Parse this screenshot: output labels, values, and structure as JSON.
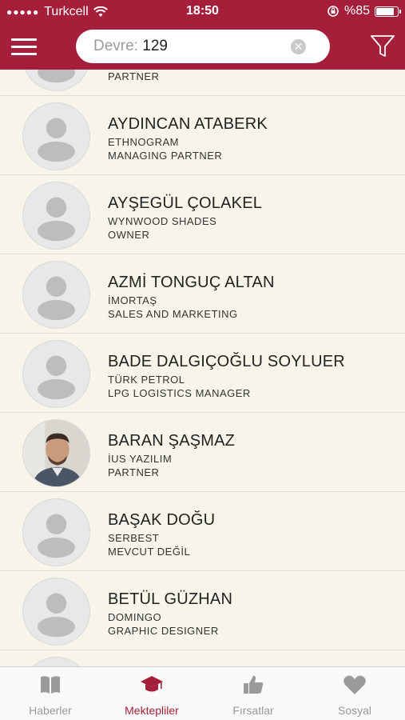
{
  "status_bar": {
    "carrier": "Turkcell",
    "time": "18:50",
    "battery": "%85",
    "battery_level": 0.85
  },
  "search": {
    "placeholder": "Devre:",
    "value": "129"
  },
  "list": {
    "partial_top": {
      "title": "PARTNER"
    },
    "members": [
      {
        "name": "AYDINCAN ATABERK",
        "company": "ETHNOGRAM",
        "title": "MANAGING PARTNER",
        "photo": false
      },
      {
        "name": "AYŞEGÜL ÇOLAKEL",
        "company": "WYNWOOD SHADES",
        "title": "OWNER",
        "photo": false
      },
      {
        "name": "AZMİ TONGUÇ ALTAN",
        "company": "İMORTAŞ",
        "title": "SALES AND MARKETING",
        "photo": false
      },
      {
        "name": "BADE DALGIÇOĞLU SOYLUER",
        "company": "TÜRK PETROL",
        "title": "LPG LOGISTICS MANAGER",
        "photo": false
      },
      {
        "name": "BARAN ŞAŞMAZ",
        "company": "İUS YAZILIM",
        "title": "PARTNER",
        "photo": true
      },
      {
        "name": "BAŞAK DOĞU",
        "company": "SERBEST",
        "title": "MEVCUT DEĞİL",
        "photo": false
      },
      {
        "name": "BETÜL GÜZHAN",
        "company": "DOMINGO",
        "title": "GRAPHIC DESIGNER",
        "photo": false
      }
    ]
  },
  "tabbar": {
    "tabs": [
      {
        "label": "Haberler",
        "icon": "book-icon",
        "active": false
      },
      {
        "label": "Mektepliler",
        "icon": "graduation-cap-icon",
        "active": true
      },
      {
        "label": "Fırsatlar",
        "icon": "thumbs-up-icon",
        "active": false
      },
      {
        "label": "Sosyal",
        "icon": "heart-icon",
        "active": false
      }
    ]
  },
  "colors": {
    "brand": "#a51f3b",
    "background": "#f7f5e9",
    "tab_inactive": "#999999"
  }
}
